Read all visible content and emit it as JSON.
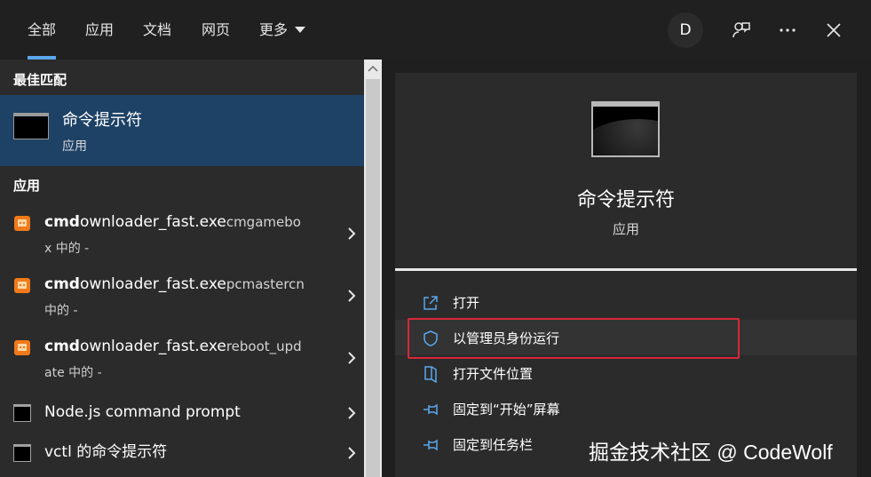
{
  "tabs": [
    {
      "label": "全部",
      "active": true
    },
    {
      "label": "应用",
      "active": false
    },
    {
      "label": "文档",
      "active": false
    },
    {
      "label": "网页",
      "active": false
    },
    {
      "label": "更多",
      "active": false
    }
  ],
  "header": {
    "avatar_letter": "D",
    "feedback_icon": "feedback-icon",
    "more_icon": "more-icon",
    "close_icon": "close-icon"
  },
  "left": {
    "best_match_heading": "最佳匹配",
    "best_match": {
      "title": "命令提示符",
      "subtitle": "应用"
    },
    "apps_heading": "应用",
    "items": [
      {
        "bold": "cmd",
        "normal": "ownloader_fast.exe",
        "light": "cmgamebo",
        "line2": "x 中的 -"
      },
      {
        "bold": "cmd",
        "normal": "ownloader_fast.exe",
        "light": "pcmastercn",
        "line2": "中的 -"
      },
      {
        "bold": "cmd",
        "normal": "ownloader_fast.exe",
        "light": "reboot_upd",
        "line2": "ate 中的 -"
      },
      {
        "label": "Node.js command prompt"
      },
      {
        "label": "vctl 的命令提示符"
      }
    ]
  },
  "right": {
    "app_name": "命令提示符",
    "app_type": "应用",
    "actions": [
      {
        "label": "打开",
        "icon": "open-icon"
      },
      {
        "label": "以管理员身份运行",
        "icon": "admin-shield-icon"
      },
      {
        "label": "打开文件位置",
        "icon": "folder-location-icon"
      },
      {
        "label": "固定到“开始”屏幕",
        "icon": "pin-icon"
      },
      {
        "label": "固定到任务栏",
        "icon": "pin-icon"
      }
    ]
  },
  "watermark": "掘金技术社区 @ CodeWolf",
  "colors": {
    "accent": "#5aa7ee",
    "selection": "#1e4266",
    "highlight_border": "#d9283a"
  }
}
